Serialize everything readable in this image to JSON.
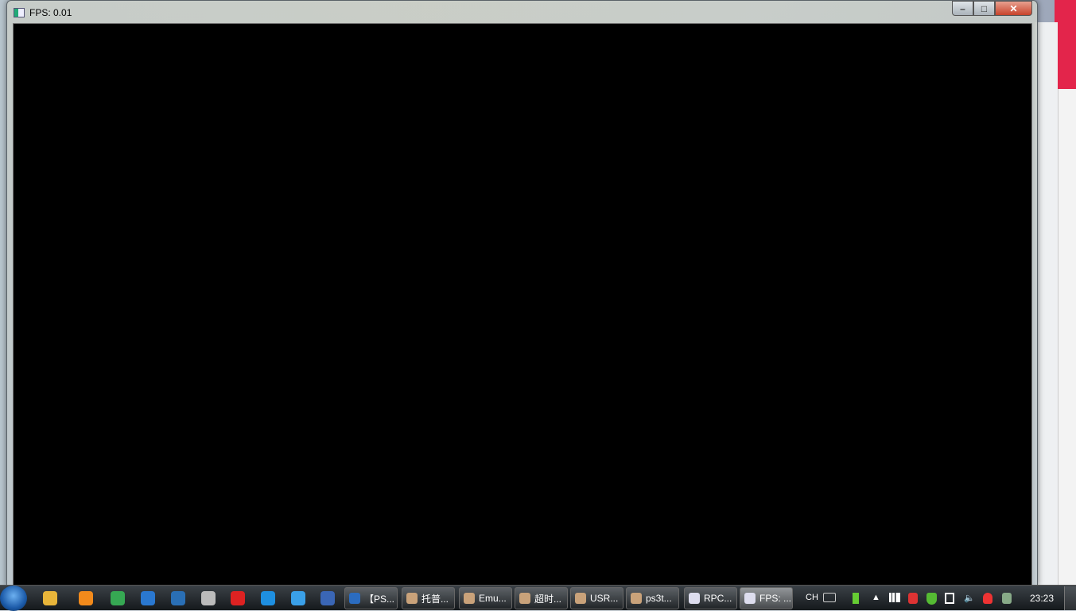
{
  "window": {
    "title": "FPS: 0.01",
    "minimize": "–",
    "maximize": "□",
    "close": "✕"
  },
  "taskbar": {
    "pinned": [
      "colorful-app",
      "paint-app",
      "chrome",
      "ie-blue-app",
      "pencil-app",
      "media-reel",
      "video-player",
      "baidu-cloud",
      "cloud-app",
      "five-app"
    ],
    "pinned_colors": [
      "#e8b53a",
      "#f28a1b",
      "#36a853",
      "#2a78d0",
      "#2a6fb5",
      "#bbbbbb",
      "#d22",
      "#1e8fe0",
      "#3aa0e8",
      "#3a66b5"
    ],
    "tasks": [
      {
        "label": "【PS...",
        "active": false
      },
      {
        "label": "托普...",
        "active": false
      },
      {
        "label": "Emu...",
        "active": false
      },
      {
        "label": "超时...",
        "active": false
      },
      {
        "label": "USR...",
        "active": false
      },
      {
        "label": "ps3t...",
        "active": false
      },
      {
        "label": "RPC...",
        "active": false
      },
      {
        "label": "FPS: ...",
        "active": true
      }
    ],
    "tray": {
      "language": "CH",
      "clock": "23:23"
    }
  }
}
